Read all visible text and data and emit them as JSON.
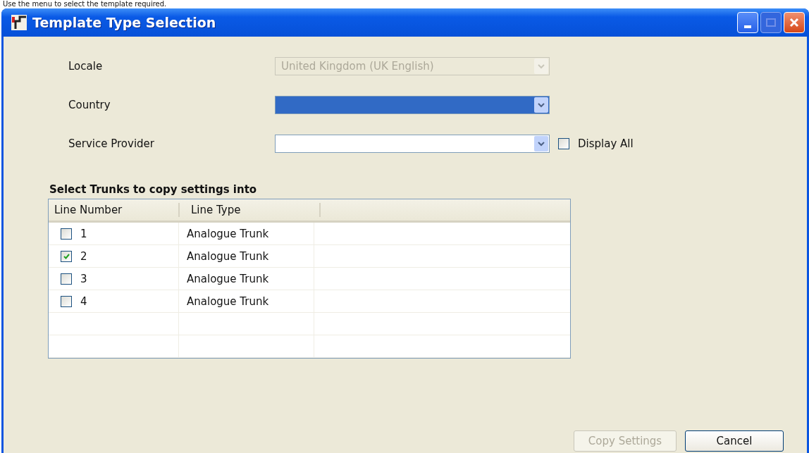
{
  "page_text": "Use the menu to select the template required.",
  "window": {
    "title": "Template Type Selection"
  },
  "fields": [
    {
      "label": "Locale",
      "value": "United Kingdom (UK English)",
      "disabled": true,
      "focused": false
    },
    {
      "label": "Country",
      "disabled": false,
      "focused": true
    },
    {
      "label": "Service Provider",
      "disabled": false,
      "focused": false
    }
  ],
  "display_all": {
    "label": "Display All",
    "checked": false
  },
  "section_title": "Select Trunks to copy settings into",
  "table": {
    "columns": [
      "Line Number",
      "Line Type"
    ],
    "rows": [
      {
        "line_number": "1",
        "line_type": "Analogue Trunk",
        "checked": false
      },
      {
        "line_number": "2",
        "line_type": "Analogue Trunk",
        "checked": true
      },
      {
        "line_number": "3",
        "line_type": "Analogue Trunk",
        "checked": false
      },
      {
        "line_number": "4",
        "line_type": "Analogue Trunk",
        "checked": false
      }
    ]
  },
  "buttons": [
    {
      "label": "Copy Settings",
      "disabled": true
    },
    {
      "label": "Cancel",
      "disabled": false
    }
  ]
}
